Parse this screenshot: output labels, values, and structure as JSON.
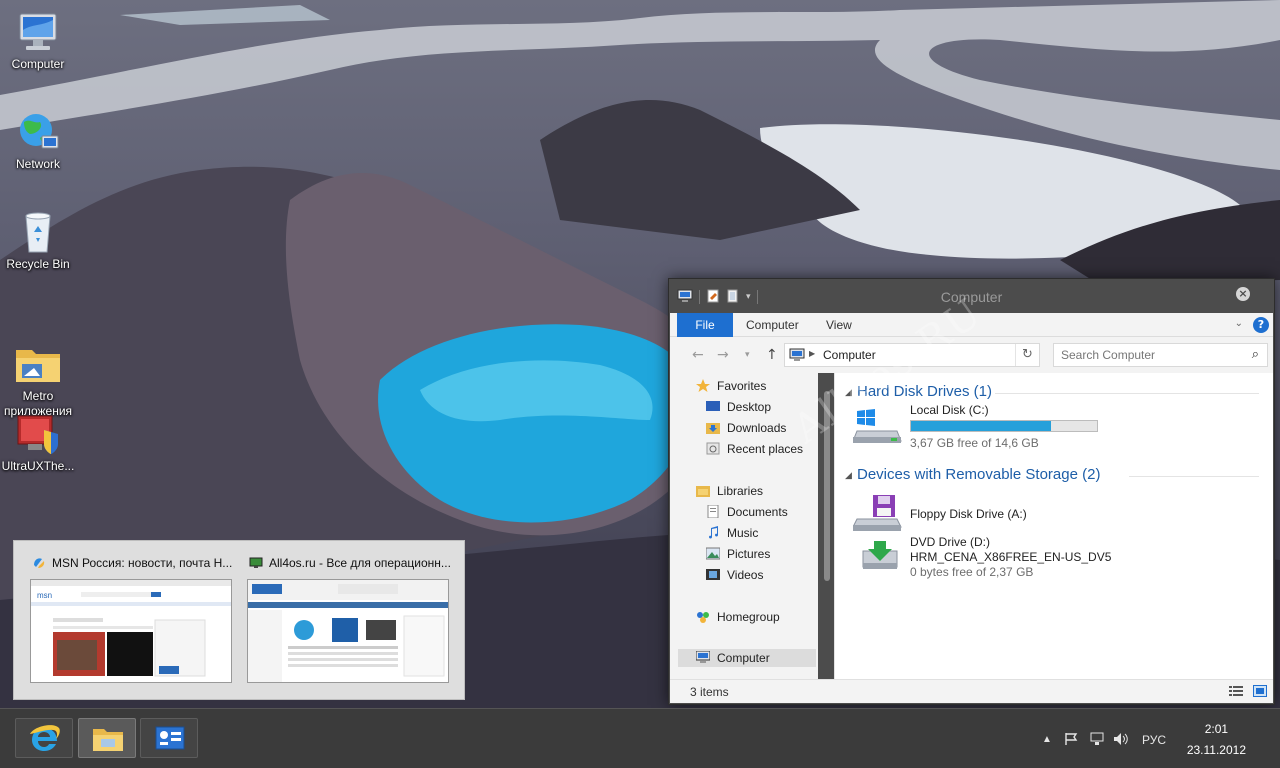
{
  "desktop": {
    "icons": [
      {
        "label": "Computer",
        "icon": "computer-icon"
      },
      {
        "label": "Network",
        "icon": "network-icon"
      },
      {
        "label": "Recycle Bin",
        "icon": "recycle-bin-icon"
      },
      {
        "label": "Metro\nприложения",
        "icon": "folder-icon"
      },
      {
        "label": "UltraUXThe...",
        "icon": "app-icon"
      }
    ]
  },
  "explorer": {
    "title": "Computer",
    "ribbon_tabs": {
      "file": "File",
      "computer": "Computer",
      "view": "View"
    },
    "address": "Computer",
    "search_placeholder": "Search Computer",
    "nav": {
      "favorites": "Favorites",
      "desktop": "Desktop",
      "downloads": "Downloads",
      "recent": "Recent places",
      "libraries": "Libraries",
      "documents": "Documents",
      "music": "Music",
      "pictures": "Pictures",
      "videos": "Videos",
      "homegroup": "Homegroup",
      "computer": "Computer"
    },
    "groups": {
      "hdd": "Hard Disk Drives (1)",
      "removable": "Devices with Removable Storage (2)"
    },
    "drives": {
      "c": {
        "name": "Local Disk (C:)",
        "free": "3,67 GB free of 14,6 GB",
        "used_fraction": 0.75
      },
      "a": {
        "name": "Floppy Disk Drive (A:)"
      },
      "d": {
        "name": "DVD Drive (D:)",
        "label": "HRM_CENA_X86FREE_EN-US_DV5",
        "free": "0 bytes free of 2,37 GB"
      }
    },
    "status": "3 items"
  },
  "watermark": "All4os.RU",
  "thumbnails": [
    {
      "title": "MSN Россия: новости, почта Н..."
    },
    {
      "title": "All4os.ru - Все для операционн..."
    }
  ],
  "taskbar": {
    "tray_lang": "РУС",
    "time": "2:01",
    "date": "23.11.2012"
  },
  "colors": {
    "accent": "#1e6fd0",
    "group_heading": "#1e5ea8",
    "progress": "#26a0da"
  }
}
